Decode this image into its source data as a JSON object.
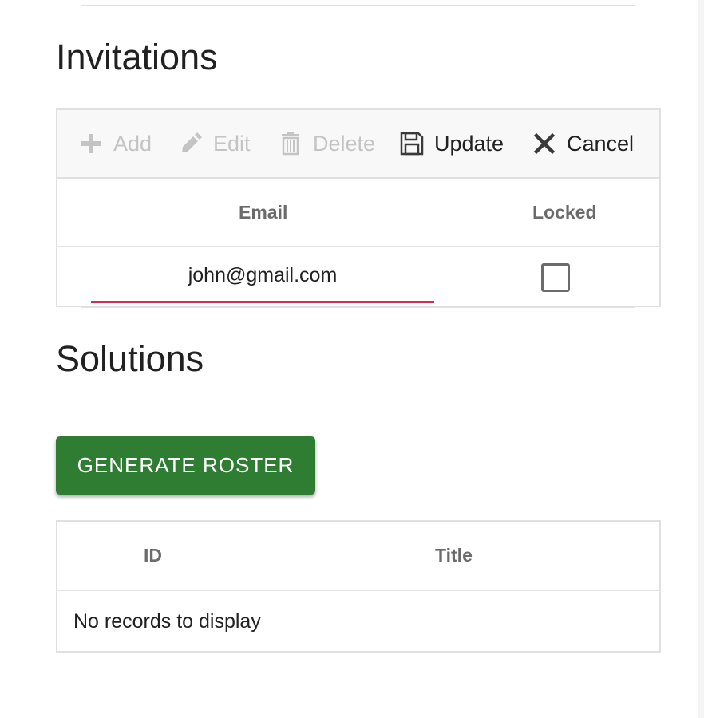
{
  "invitations": {
    "title": "Invitations",
    "toolbar": {
      "add_label": "Add",
      "edit_label": "Edit",
      "delete_label": "Delete",
      "update_label": "Update",
      "cancel_label": "Cancel",
      "icons": {
        "add": "plus-icon",
        "edit": "pencil-icon",
        "delete": "trash-icon",
        "update": "save-icon",
        "cancel": "close-icon"
      }
    },
    "columns": [
      "Email",
      "Locked"
    ],
    "edit_row": {
      "email_value": "john@gmail.com",
      "locked": false
    }
  },
  "solutions": {
    "title": "Solutions",
    "generate_button_label": "GENERATE ROSTER",
    "columns": [
      "ID",
      "Title"
    ],
    "empty_message": "No records to display"
  },
  "colors": {
    "primary_button": "#2e7d32",
    "input_underline": "#d12c5c",
    "disabled_text": "#c4c4c4",
    "header_text": "#6b6b6b",
    "border": "#e0e0e0",
    "toolbar_bg": "#f8f8f8"
  }
}
